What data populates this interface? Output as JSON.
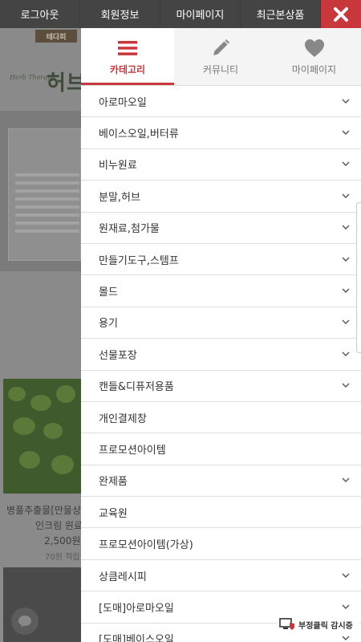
{
  "topbar": {
    "items": [
      "로그아웃",
      "회원정보",
      "마이페이지",
      "최근본상품"
    ],
    "close_icon": "close-icon",
    "close_color": "#c8373b"
  },
  "background_page": {
    "logo_text": "테다피",
    "brand_small": "Herb Therapy",
    "brand_text": "허브",
    "product_name_line1": "병풀추출물[만물상",
    "product_name_line2": "인크림 원료",
    "product_price": "2,500원",
    "product_point": "70원 적립"
  },
  "tabs": [
    {
      "label": "카테고리",
      "icon": "menu-icon",
      "active": true
    },
    {
      "label": "커뮤니티",
      "icon": "pencil-icon",
      "active": false
    },
    {
      "label": "마이페이지",
      "icon": "heart-icon",
      "active": false
    }
  ],
  "menu": [
    {
      "label": "아로마오일",
      "has_sub": true
    },
    {
      "label": "베이스오일,버터류",
      "has_sub": true
    },
    {
      "label": "비누원료",
      "has_sub": true
    },
    {
      "label": "분말,허브",
      "has_sub": true
    },
    {
      "label": "원재료,첨가물",
      "has_sub": true
    },
    {
      "label": "만들기도구,스템프",
      "has_sub": true
    },
    {
      "label": "몰드",
      "has_sub": true
    },
    {
      "label": "용기",
      "has_sub": true
    },
    {
      "label": "선물포장",
      "has_sub": true
    },
    {
      "label": "캔들&디퓨저용품",
      "has_sub": true
    },
    {
      "label": "개인결제창",
      "has_sub": false
    },
    {
      "label": "프로모션아이템",
      "has_sub": false
    },
    {
      "label": "완제품",
      "has_sub": true
    },
    {
      "label": "교육원",
      "has_sub": false
    },
    {
      "label": "프로모션아이템(가상)",
      "has_sub": false
    },
    {
      "label": "상큼레시피",
      "has_sub": true
    },
    {
      "label": "[도매]아로마오일",
      "has_sub": true
    },
    {
      "label": "[도매]베이스오일",
      "has_sub": true
    }
  ],
  "fraud_badge": {
    "label": "부정클릭 감시중"
  },
  "colors": {
    "accent": "#c8373b",
    "topbar": "#444444"
  }
}
